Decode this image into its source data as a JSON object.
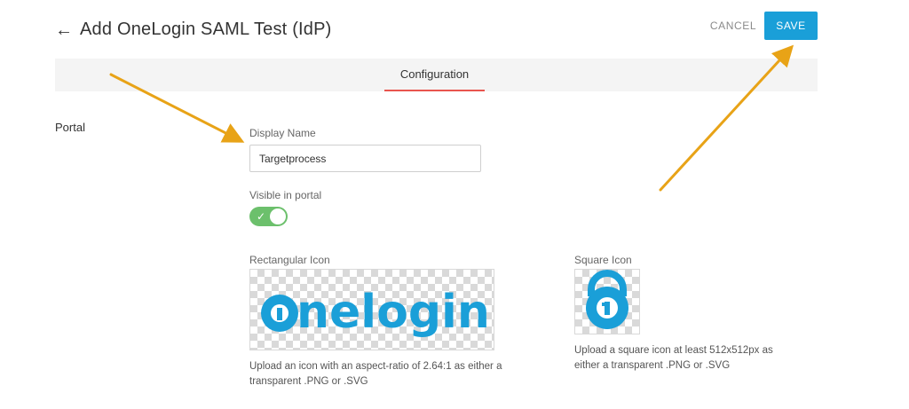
{
  "header": {
    "title": "Add OneLogin SAML Test (IdP)",
    "back_icon": "back-arrow-icon",
    "cancel_label": "CANCEL",
    "save_label": "SAVE"
  },
  "tabs": [
    {
      "label": "Configuration",
      "active": true
    }
  ],
  "section": {
    "label": "Portal"
  },
  "display_name": {
    "label": "Display Name",
    "value": "Targetprocess"
  },
  "visible_in_portal": {
    "label": "Visible in portal",
    "on": true
  },
  "rectangular_icon": {
    "label": "Rectangular Icon",
    "logo_text": "onelogin",
    "help_line1": "Upload an icon with an aspect-ratio of 2.64:1 as either a",
    "help_line2": "transparent .PNG or .SVG"
  },
  "square_icon": {
    "label": "Square Icon",
    "help_line1": "Upload a square icon at least 512x512px as",
    "help_line2": "either a transparent .PNG or .SVG"
  },
  "colors": {
    "accent": "#1a9fd8",
    "tab_underline": "#e8554e",
    "toggle_on": "#6cc06c",
    "annotation_arrow": "#e8a317",
    "logo_blue": "#1a9fd8"
  }
}
